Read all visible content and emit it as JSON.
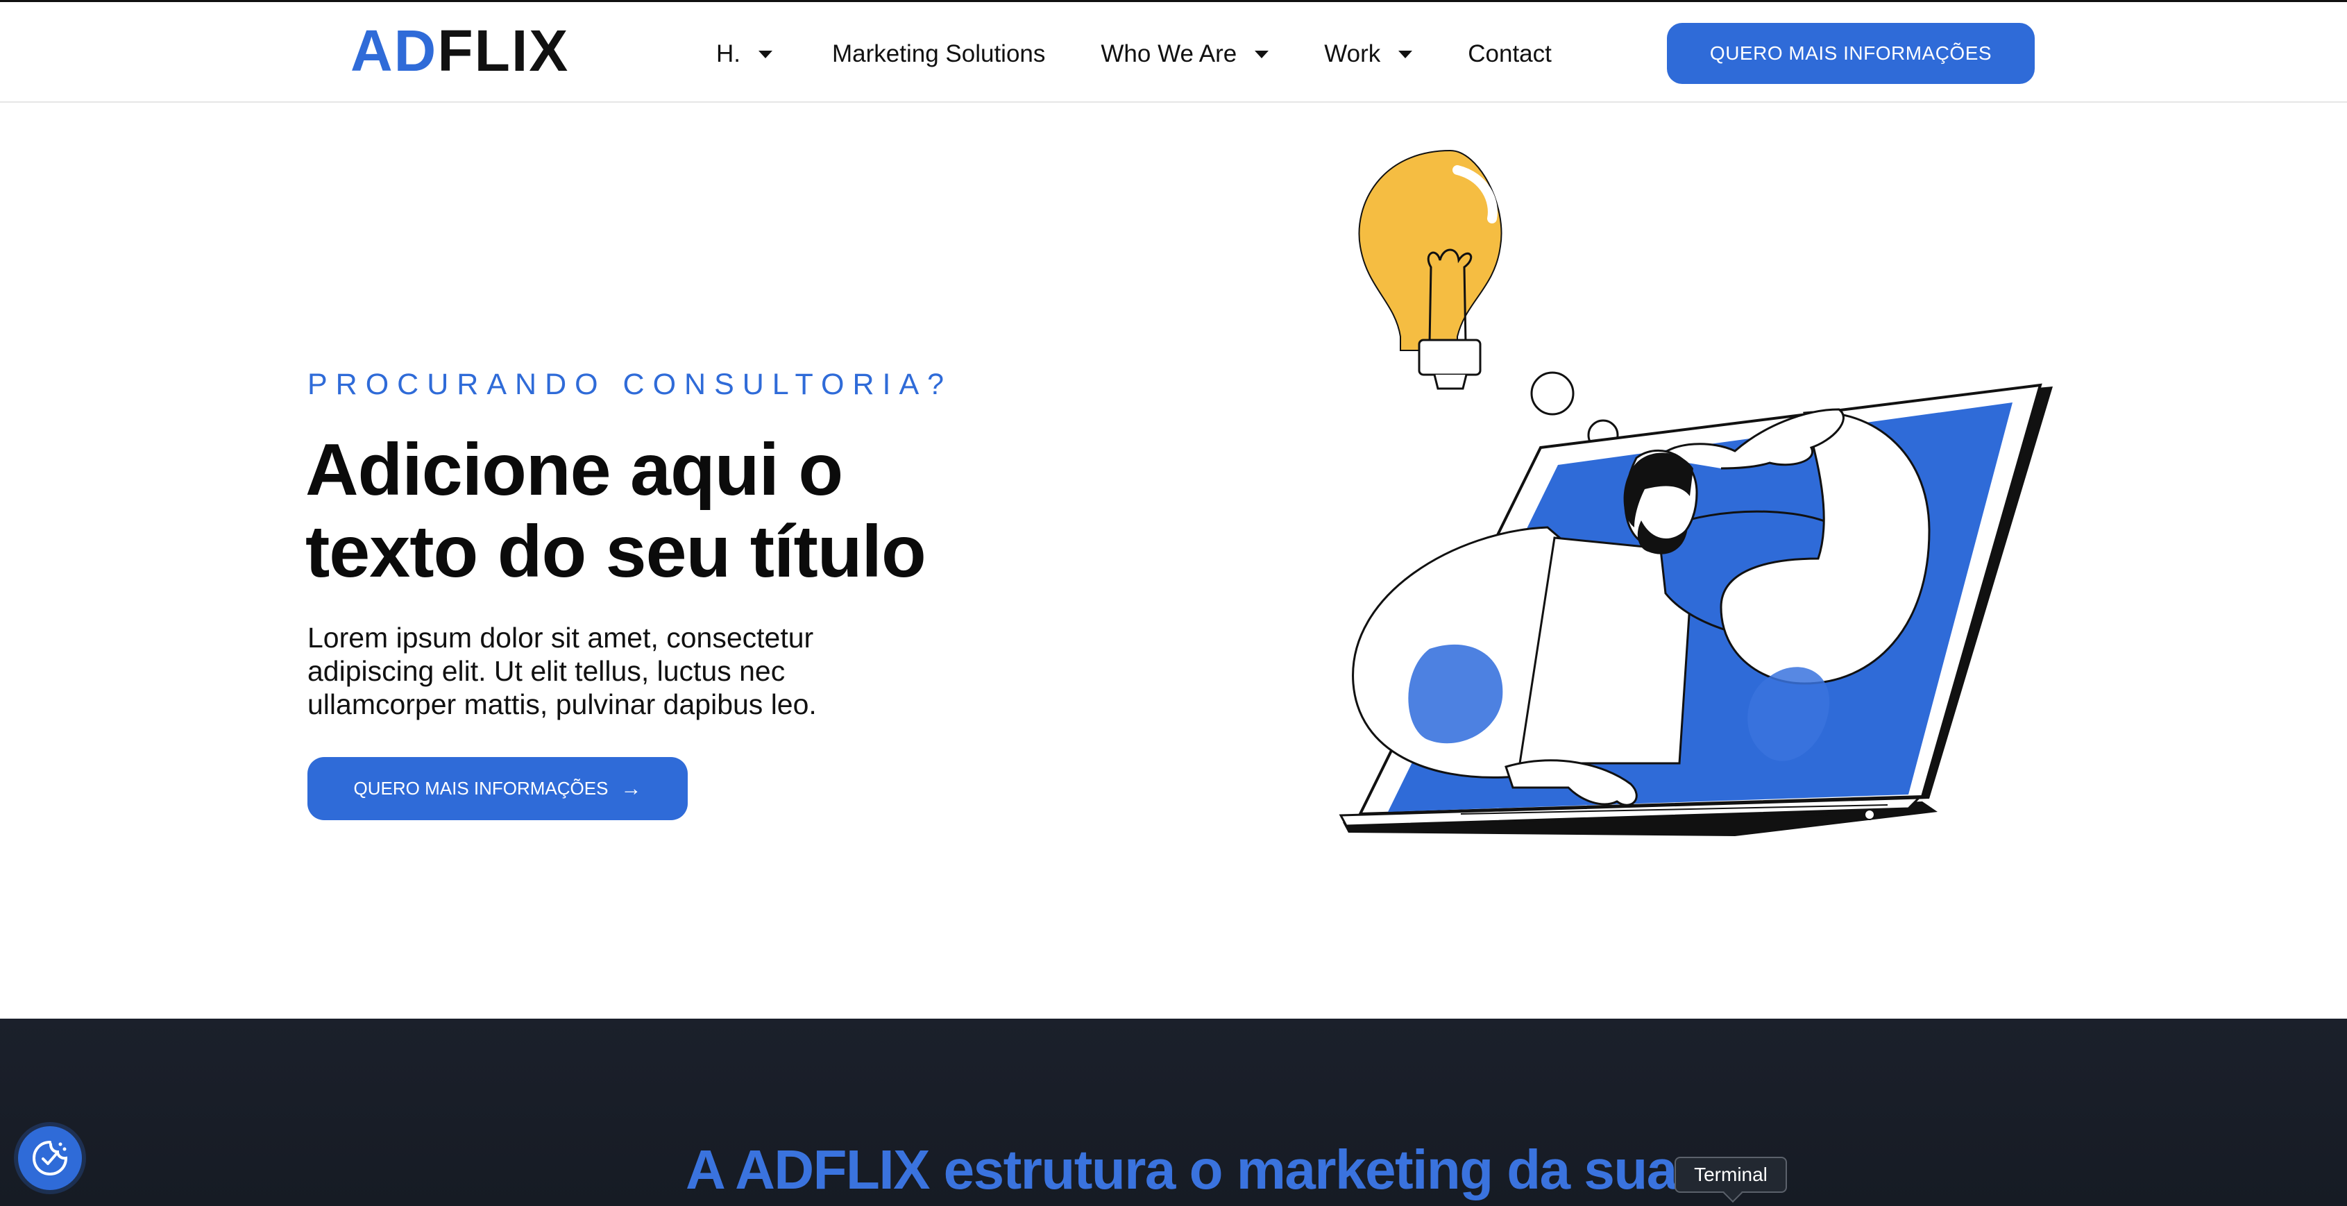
{
  "colors": {
    "accent": "#2f6bd8",
    "dark_bg": "#1b202b",
    "bulb": "#f5bd42"
  },
  "header": {
    "logo": {
      "part1": "AD",
      "part2": "FLIX"
    },
    "nav": [
      {
        "label": "H.",
        "has_dropdown": true
      },
      {
        "label": "Marketing Solutions",
        "has_dropdown": false
      },
      {
        "label": "Who We Are",
        "has_dropdown": true
      },
      {
        "label": "Work",
        "has_dropdown": true
      },
      {
        "label": "Contact",
        "has_dropdown": false
      }
    ],
    "cta_label": "QUERO MAIS INFORMAÇÕES"
  },
  "hero": {
    "eyebrow": "PROCURANDO CONSULTORIA?",
    "title_line1": "Adicione aqui o",
    "title_line2": "texto do seu título",
    "description": "Lorem ipsum dolor sit amet, consectetur adipiscing elit. Ut elit tellus, luctus nec ullamcorper mattis, pulvinar dapibus leo.",
    "cta_label": "QUERO MAIS INFORMAÇÕES",
    "cta_icon": "arrow-right-icon",
    "illustration": "man-in-laptop-with-lightbulb-illustration"
  },
  "section2": {
    "heading": "A ADFLIX estrutura o marketing da sua"
  },
  "tooltip": {
    "label": "Terminal"
  },
  "cookie_badge": {
    "icon": "cookie-consent-icon"
  }
}
